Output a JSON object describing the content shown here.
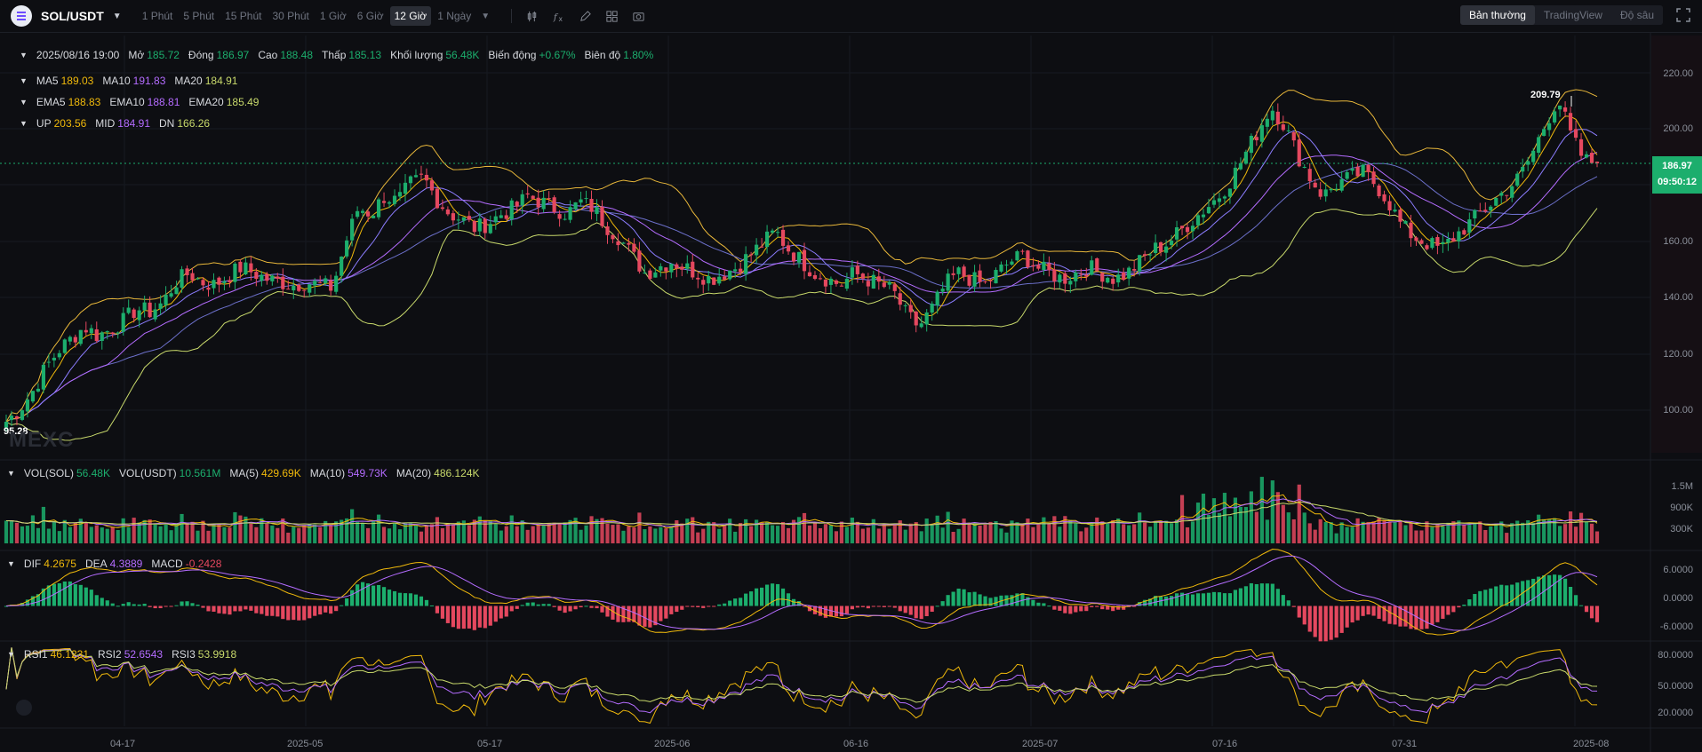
{
  "topbar": {
    "symbol": "SOL/USDT",
    "timeframes": [
      "1 Phút",
      "5 Phút",
      "15 Phút",
      "30 Phút",
      "1 Giờ",
      "6 Giờ",
      "12 Giờ",
      "1 Ngày"
    ],
    "active_timeframe": "12 Giờ",
    "view_tabs": [
      "Bản thường",
      "TradingView",
      "Độ sâu"
    ],
    "active_view": "Bản thường"
  },
  "ohlc": {
    "date": "2025/08/16 19:00",
    "open_label": "Mở",
    "open": "185.72",
    "close_label": "Đóng",
    "close": "186.97",
    "high_label": "Cao",
    "high": "188.48",
    "low_label": "Thấp",
    "low": "185.13",
    "volume_label": "Khối lượng",
    "volume": "56.48K",
    "change_label": "Biến động",
    "change": "+0.67%",
    "amplitude_label": "Biên độ",
    "amplitude": "1.80%"
  },
  "ma": {
    "ma5_label": "MA5",
    "ma5": "189.03",
    "ma10_label": "MA10",
    "ma10": "191.83",
    "ma20_label": "MA20",
    "ma20": "184.91"
  },
  "ema": {
    "ema5_label": "EMA5",
    "ema5": "188.83",
    "ema10_label": "EMA10",
    "ema10": "188.81",
    "ema20_label": "EMA20",
    "ema20": "185.49"
  },
  "boll": {
    "up_label": "UP",
    "up": "203.56",
    "mid_label": "MID",
    "mid": "184.91",
    "dn_label": "DN",
    "dn": "166.26"
  },
  "vol": {
    "sol_label": "VOL(SOL)",
    "sol": "56.48K",
    "usdt_label": "VOL(USDT)",
    "usdt": "10.561M",
    "ma5_label": "MA(5)",
    "ma5": "429.69K",
    "ma10_label": "MA(10)",
    "ma10": "549.73K",
    "ma20_label": "MA(20)",
    "ma20": "486.124K"
  },
  "macd": {
    "dif_label": "DIF",
    "dif": "4.2675",
    "dea_label": "DEA",
    "dea": "4.3889",
    "macd_label": "MACD",
    "macd": "-0.2428"
  },
  "rsi": {
    "rsi1_label": "RSI1",
    "rsi1": "46.1231",
    "rsi2_label": "RSI2",
    "rsi2": "52.6543",
    "rsi3_label": "RSI3",
    "rsi3": "53.9918"
  },
  "price_axis": [
    "220.00",
    "200.00",
    "180.00",
    "160.00",
    "140.00",
    "120.00",
    "100.00"
  ],
  "vol_axis": [
    "1.5M",
    "900K",
    "300K"
  ],
  "macd_axis": [
    "6.0000",
    "0.0000",
    "-6.0000"
  ],
  "rsi_axis": [
    "80.0000",
    "50.0000",
    "20.0000"
  ],
  "current_price": "186.97",
  "countdown": "09:50:12",
  "high_marker": "209.79",
  "low_marker": "95.28",
  "watermark": "MEXC",
  "x_axis": [
    "04-17",
    "2025-05",
    "05-17",
    "2025-06",
    "06-16",
    "2025-07",
    "07-16",
    "07-31",
    "2025-08"
  ],
  "colors": {
    "up": "#1cae6d",
    "down": "#e5485f",
    "ma5": "#f0b90b",
    "ma10": "#b46cff",
    "ma20": "#c8d96b",
    "boll": "#e8b73a",
    "bg": "#0d0e12"
  },
  "chart_data": {
    "type": "candlestick",
    "title": "SOL/USDT 12 Giờ",
    "xlabel": "",
    "ylabel": "",
    "ylim": [
      88,
      230
    ],
    "close_path": [
      100,
      104,
      110,
      118,
      124,
      128,
      132,
      129,
      131,
      134,
      138,
      137,
      140,
      147,
      150,
      147,
      146,
      149,
      152,
      150,
      148,
      147,
      146,
      147,
      146,
      145,
      160,
      172,
      170,
      176,
      174,
      180,
      182,
      175,
      170,
      168,
      165,
      167,
      170,
      172,
      176,
      174,
      172,
      170,
      174,
      172,
      166,
      162,
      156,
      150,
      152,
      154,
      152,
      150,
      148,
      150,
      152,
      156,
      160,
      164,
      158,
      154,
      150,
      148,
      146,
      150,
      148,
      146,
      144,
      136,
      132,
      138,
      146,
      150,
      148,
      146,
      150,
      154,
      156,
      152,
      150,
      148,
      150,
      152,
      150,
      148,
      150,
      154,
      158,
      160,
      164,
      168,
      172,
      176,
      182,
      190,
      198,
      206,
      200,
      190,
      182,
      176,
      180,
      182,
      184,
      180,
      174,
      166,
      162,
      160,
      158,
      162,
      166,
      170,
      174,
      178,
      182,
      190,
      200,
      209,
      196,
      188,
      187
    ]
  }
}
